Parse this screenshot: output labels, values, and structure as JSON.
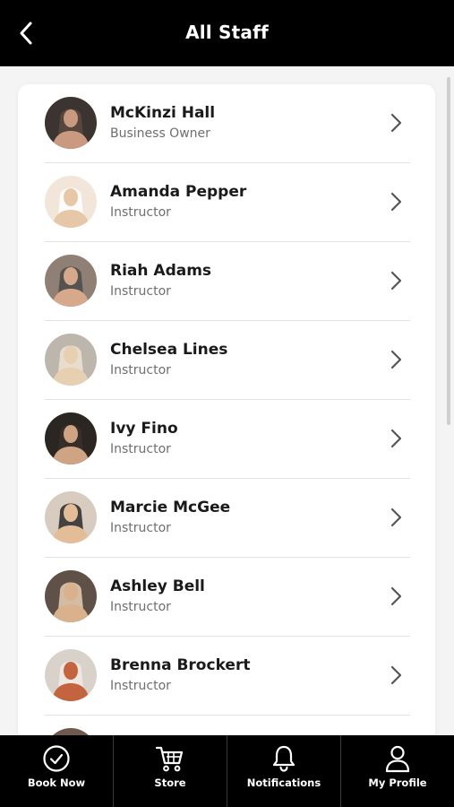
{
  "header": {
    "title": "All Staff",
    "back_icon": "chevron-left-icon"
  },
  "staff": [
    {
      "name": "McKinzi Hall",
      "role": "Business Owner",
      "avatar_colors": [
        "#3b3431",
        "#c99a80",
        "#5c4a40"
      ]
    },
    {
      "name": "Amanda Pepper",
      "role": "Instructor",
      "avatar_colors": [
        "#f2e6da",
        "#e6c8a8",
        "#ffffff"
      ]
    },
    {
      "name": "Riah Adams",
      "role": "Instructor",
      "avatar_colors": [
        "#8f7f74",
        "#d7a98c",
        "#4b4b4b"
      ]
    },
    {
      "name": "Chelsea Lines",
      "role": "Instructor",
      "avatar_colors": [
        "#bdb6ad",
        "#e7cfb1",
        "#f0e4d2"
      ]
    },
    {
      "name": "Ivy Fino",
      "role": "Instructor",
      "avatar_colors": [
        "#2b2622",
        "#cfa484",
        "#3a302a"
      ]
    },
    {
      "name": "Marcie McGee",
      "role": "Instructor",
      "avatar_colors": [
        "#d8cbc0",
        "#e3bd98",
        "#2a2a2a"
      ]
    },
    {
      "name": "Ashley Bell",
      "role": "Instructor",
      "avatar_colors": [
        "#5f5148",
        "#d9b28d",
        "#e6cfb5"
      ]
    },
    {
      "name": "Brenna Brockert",
      "role": "Instructor",
      "avatar_colors": [
        "#d9d2cb",
        "#c3643f",
        "#f1ebe5"
      ]
    },
    {
      "name": "",
      "role": "",
      "avatar_colors": [
        "#6e5a4e",
        "#c99574",
        "#3b3029"
      ]
    }
  ],
  "tabs": [
    {
      "label": "Book Now",
      "icon": "check-circle-icon"
    },
    {
      "label": "Store",
      "icon": "cart-icon"
    },
    {
      "label": "Notifications",
      "icon": "bell-icon"
    },
    {
      "label": "My Profile",
      "icon": "user-icon"
    }
  ]
}
